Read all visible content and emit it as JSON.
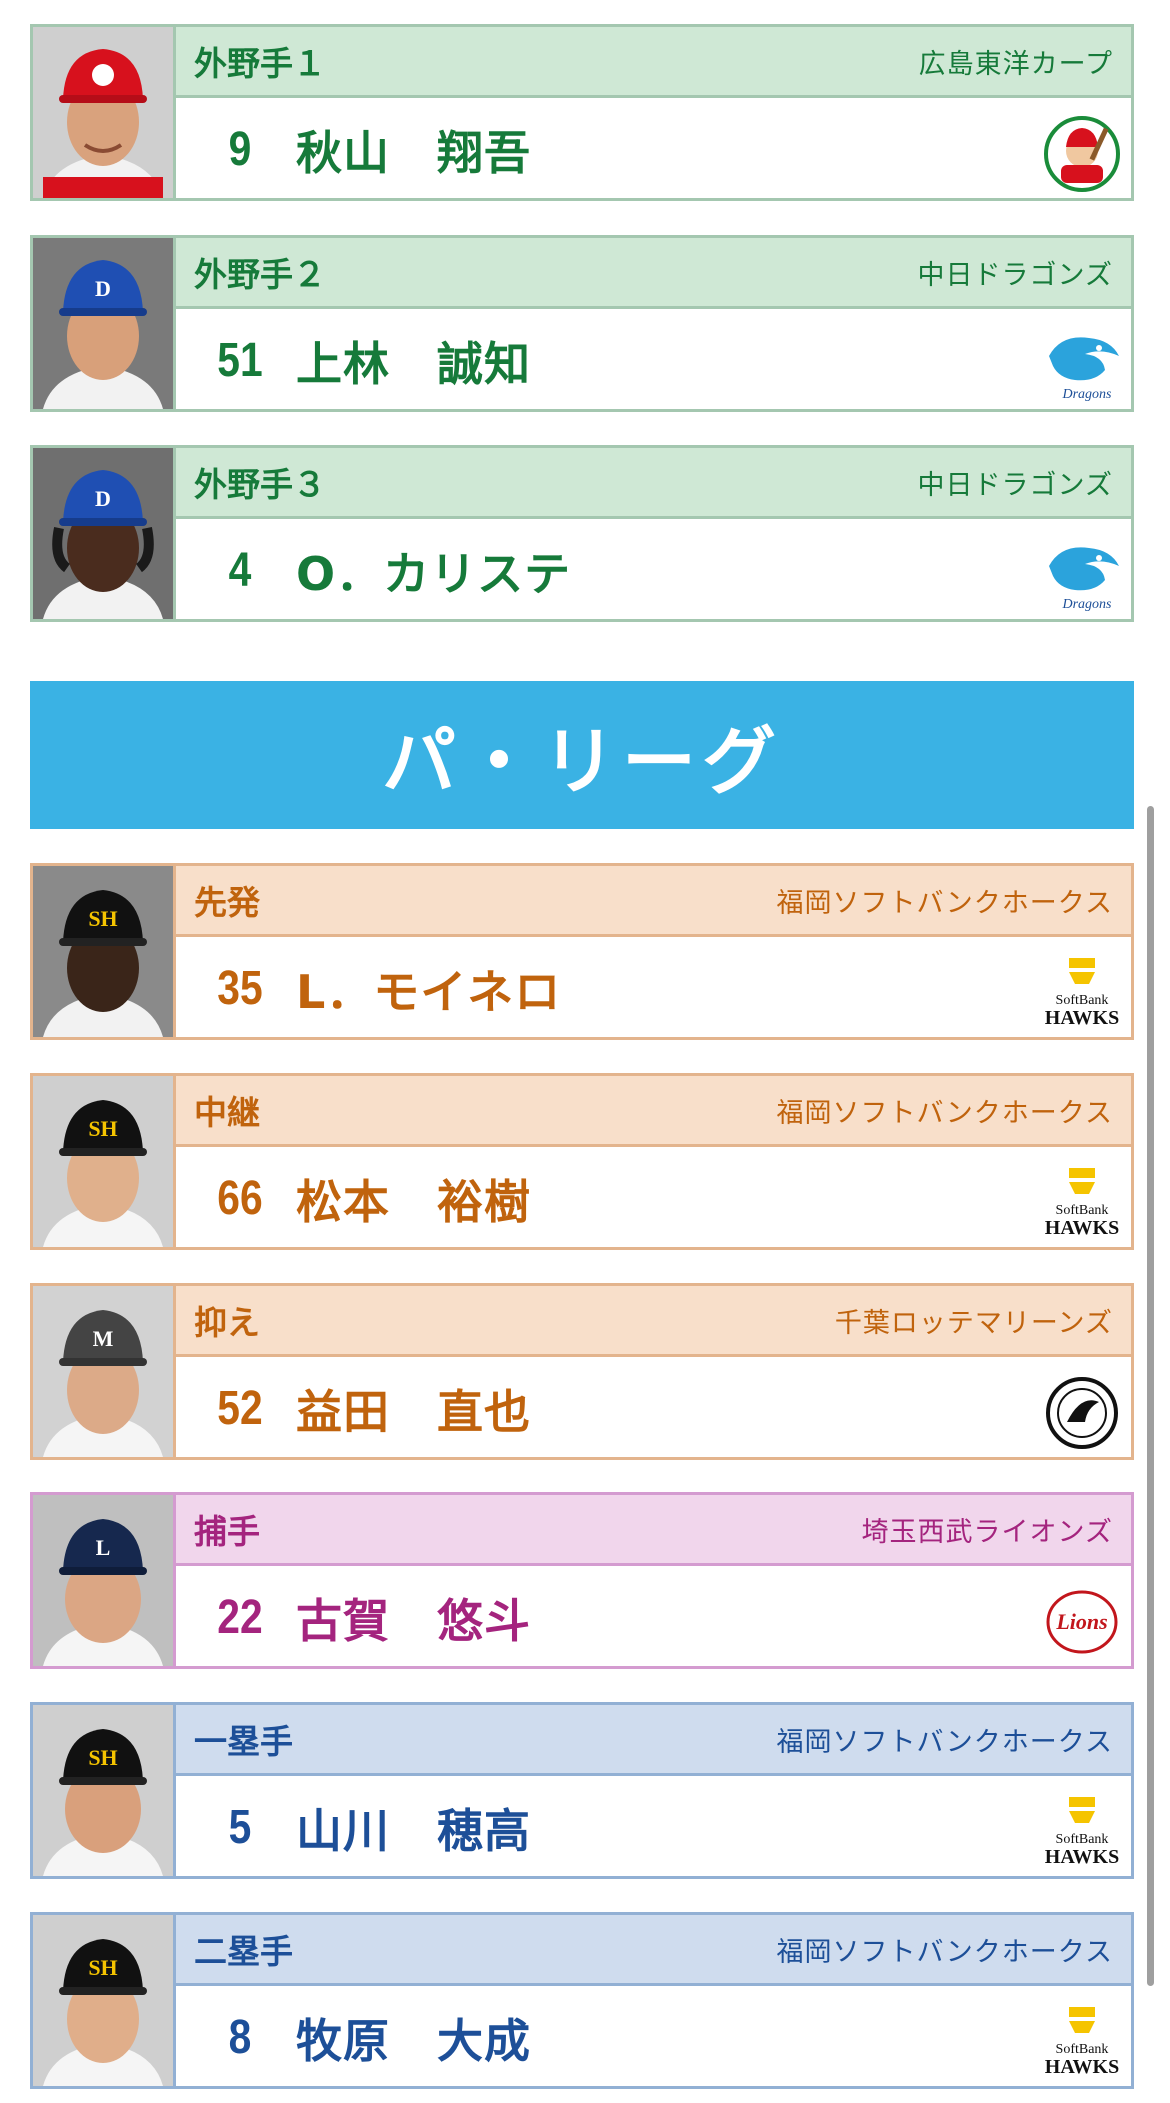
{
  "central_league_cards": [
    {
      "position": "外野手１",
      "team": "広島東洋カープ",
      "number": "9",
      "name": "秋山　翔吾",
      "theme": "#167a3a",
      "logo": "carp-logo",
      "cap_color": "#d7111d"
    },
    {
      "position": "外野手２",
      "team": "中日ドラゴンズ",
      "number": "51",
      "name": "上林　誠知",
      "theme": "#167a3a",
      "logo": "dragons-logo",
      "cap_color": "#1f4fb3"
    },
    {
      "position": "外野手３",
      "team": "中日ドラゴンズ",
      "number": "4",
      "name": "O．カリステ",
      "theme": "#167a3a",
      "logo": "dragons-logo",
      "cap_color": "#1f4fb3"
    }
  ],
  "pacific_banner": "パ・リーグ",
  "pacific_league_cards": [
    {
      "position": "先発",
      "team": "福岡ソフトバンクホークス",
      "number": "35",
      "name": "L．モイネロ",
      "theme": "#c0630d",
      "logo": "hawks-logo",
      "cap_color": "#111111"
    },
    {
      "position": "中継",
      "team": "福岡ソフトバンクホークス",
      "number": "66",
      "name": "松本　裕樹",
      "theme": "#c0630d",
      "logo": "hawks-logo",
      "cap_color": "#111111"
    },
    {
      "position": "抑え",
      "team": "千葉ロッテマリーンズ",
      "number": "52",
      "name": "益田　直也",
      "theme": "#c0630d",
      "logo": "marines-logo",
      "cap_color": "#444444"
    },
    {
      "position": "捕手",
      "team": "埼玉西武ライオンズ",
      "number": "22",
      "name": "古賀　悠斗",
      "theme": "#a4247e",
      "logo": "lions-logo",
      "cap_color": "#16284e"
    },
    {
      "position": "一塁手",
      "team": "福岡ソフトバンクホークス",
      "number": "5",
      "name": "山川　穂高",
      "theme": "#1d4f98",
      "logo": "hawks-logo",
      "cap_color": "#111111"
    },
    {
      "position": "二塁手",
      "team": "福岡ソフトバンクホークス",
      "number": "8",
      "name": "牧原　大成",
      "theme": "#1d4f98",
      "logo": "hawks-logo",
      "cap_color": "#111111"
    }
  ]
}
